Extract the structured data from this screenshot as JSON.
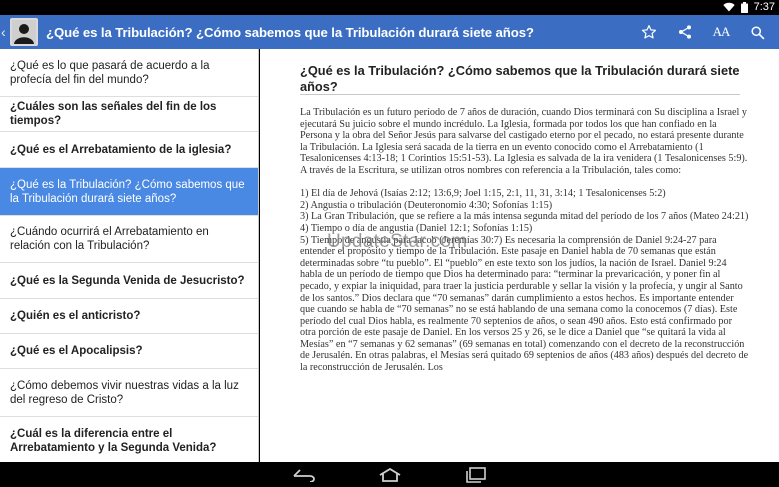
{
  "status_bar": {
    "time": "7:37"
  },
  "action_bar": {
    "title": "¿Qué es la Tribulación? ¿Cómo sabemos que la Tribulación durará siete años?",
    "text_size_label": "AA"
  },
  "sidebar": {
    "items": [
      {
        "label": "¿Qué es lo que pasará de acuerdo a la profecía del fin del mundo?",
        "bold": false,
        "selected": false
      },
      {
        "label": "¿Cuáles son las señales del fin de los tiempos?",
        "bold": true,
        "selected": false
      },
      {
        "label": "¿Qué es el Arrebatamiento de la iglesia?",
        "bold": true,
        "selected": false
      },
      {
        "label": "¿Qué es la Tribulación? ¿Cómo sabemos que la Tribulación durará siete años?",
        "bold": false,
        "selected": true
      },
      {
        "label": "¿Cuándo ocurrirá el Arrebatamiento en relación con la Tribulación?",
        "bold": false,
        "selected": false
      },
      {
        "label": "¿Qué es la Segunda Venida de Jesucristo?",
        "bold": true,
        "selected": false
      },
      {
        "label": "¿Quién es el anticristo?",
        "bold": true,
        "selected": false
      },
      {
        "label": "¿Qué es el Apocalipsis?",
        "bold": true,
        "selected": false
      },
      {
        "label": "¿Cómo debemos vivir nuestras vidas a la luz del regreso de Cristo?",
        "bold": false,
        "selected": false
      },
      {
        "label": "¿Cuál es la diferencia entre el Arrebatamiento y la Segunda Venida?",
        "bold": true,
        "selected": false
      }
    ]
  },
  "article": {
    "heading": "¿Qué es la Tribulación? ¿Cómo sabemos que la Tribulación durará siete años?",
    "intro": "La Tribulación es un futuro período de 7 años de duración, cuando Dios terminará con Su disciplina a Israel y ejecutará Su juicio sobre el mundo incrédulo. La Iglesia, formada por todos los que han confiado en la Persona y la obra del Señor Jesús para salvarse del castigado eterno por el pecado, no estará presente durante la Tribulación. La Iglesia será sacada de la tierra en un evento conocido como el Arrebatamiento (1 Tesalonicenses 4:13-18; 1 Corintios 15:51-53). La Iglesia es salvada de la ira venidera (1 Tesalonicenses 5:9). A través de la Escritura, se utilizan otros nombres con referencia a la Tribulación, tales como:",
    "list_1": "1) El día de Jehová (Isaías 2:12; 13:6,9; Joel 1:15, 2:1, 11, 31, 3:14; 1 Tesalonicenses 5:2)",
    "list_2": "2) Angustia o tribulación (Deuteronomio 4:30; Sofonías 1:15)",
    "list_3": "3) La Gran Tribulación, que se refiere a la más intensa segunda mitad del período de los 7 años (Mateo 24:21)",
    "list_4": "4) Tiempo o día de angustia (Daniel 12:1; Sofonías 1:15)",
    "list_5": "5) Tiempo de angustia para Jacob (Jeremías 30:7) Es necesaria la comprensión de Daniel 9:24-27 para entender el propósito y tiempo de la Tribulación. Este pasaje en Daniel habla de 70 semanas que están determinadas sobre “tu pueblo”. El “pueblo” en este texto son los judíos, la nación de Israel. Daniel 9:24 habla de un período de tiempo que Dios ha determinado para: “terminar la prevaricación, y poner fin al pecado, y expiar la iniquidad, para traer la justicia perdurable y sellar la visión y la profecía, y ungir al Santo de los santos.” Dios declara que “70 semanas” darán cumplimiento a estos hechos. Es importante entender que cuando se habla de “70 semanas” no se está hablando de una semana como la conocemos (7 días). Este período del cual Dios habla, es realmente 70 septenios de años, o sean 490 años. Esto está confirmado por otra porción de este pasaje de Daniel. En los versos 25 y 26, se le dice a Daniel que “se quitará la vida al Mesías” en “7 semanas y 62 semanas” (69 semanas en total) comenzando con el decreto de la reconstrucción de Jerusalén. En otras palabras, el Mesías será quitado 69 septenios de años (483 años) después del decreto de la reconstrucción de Jerusalén. Los"
  },
  "watermark": {
    "text": "UpdateStar.com"
  },
  "colors": {
    "action_bar": "#3b6ec3",
    "selected_item": "#4a89e3"
  },
  "icons": {
    "back": "chevron-left-icon",
    "favorite": "star-outline-icon",
    "share": "share-icon",
    "text_size": "text-size-icon",
    "search": "search-icon",
    "nav": [
      "back-arrow-icon",
      "home-icon",
      "recent-apps-icon"
    ]
  }
}
